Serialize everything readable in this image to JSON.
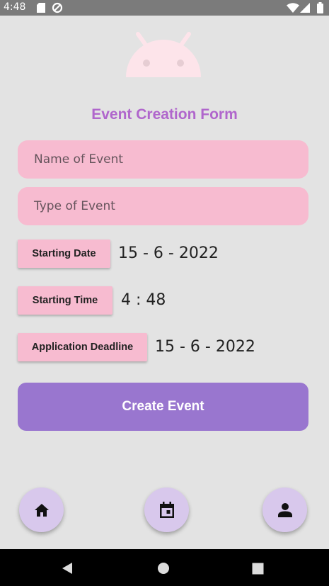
{
  "status_bar": {
    "time": "4:48",
    "icons": [
      "sd-card-icon",
      "sync-icon",
      "wifi-icon",
      "signal-icon",
      "battery-icon"
    ]
  },
  "logo": {
    "icon": "android-icon",
    "color": "#fde4ea"
  },
  "form": {
    "title": "Event Creation Form",
    "name_placeholder": "Name of Event",
    "type_placeholder": "Type of Event",
    "starting_date_label": "Starting Date",
    "starting_date_value": "15 - 6 - 2022",
    "starting_time_label": "Starting Time",
    "starting_time_value": "4 : 48",
    "deadline_label": "Application Deadline",
    "deadline_value": "15 - 6 - 2022",
    "create_label": "Create Event"
  },
  "bottom_actions": [
    {
      "icon": "home-icon"
    },
    {
      "icon": "calendar-icon"
    },
    {
      "icon": "person-icon"
    }
  ],
  "colors": {
    "background": "#e3e3e3",
    "title": "#b066cc",
    "field": "#f7bbd0",
    "primary_button": "#9976cf",
    "fab": "#d8c8ec"
  }
}
